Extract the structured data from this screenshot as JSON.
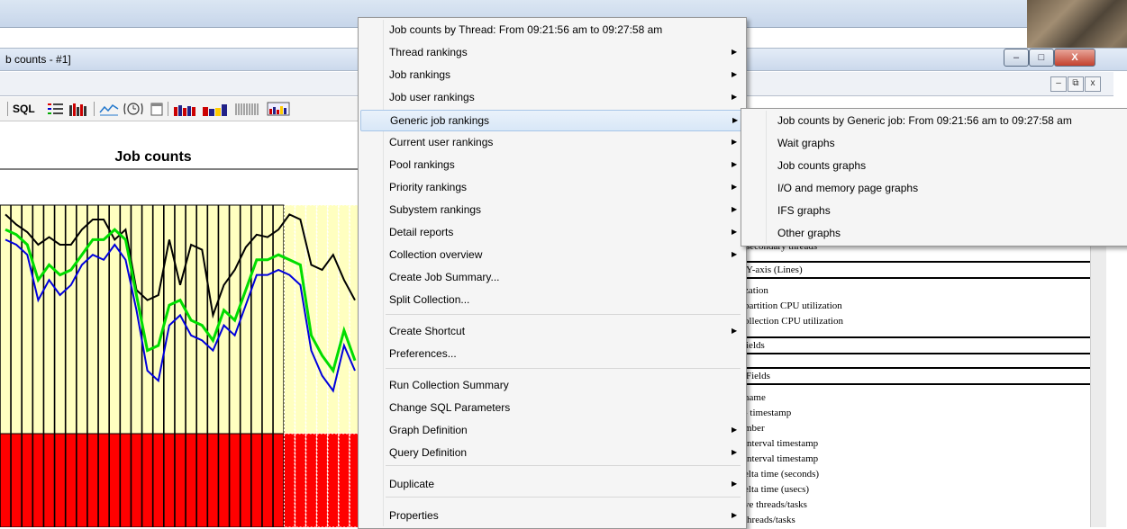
{
  "window": {
    "title": "b counts - #1]",
    "minimize": "–",
    "maximize": "□",
    "close": "X",
    "mdi_minimize": "–",
    "mdi_restore": "⧉",
    "mdi_close": "x"
  },
  "toolbar": {
    "sql": "SQL"
  },
  "chart_data": {
    "type": "bar",
    "title": "Job counts",
    "xlabel": "",
    "ylabel": "",
    "bar_colors": {
      "top": "#ffffc0",
      "bottom": "#ff0000"
    },
    "series": [
      {
        "color": "#000000",
        "values": [
          0.92,
          0.88,
          0.85,
          0.8,
          0.83,
          0.8,
          0.8,
          0.86,
          0.9,
          0.9,
          0.82,
          0.86,
          0.62,
          0.58,
          0.6,
          0.82,
          0.64,
          0.8,
          0.78,
          0.52,
          0.64,
          0.7,
          0.79,
          0.84,
          0.83,
          0.86,
          0.92,
          0.9,
          0.72,
          0.7,
          0.76,
          0.66,
          0.58
        ]
      },
      {
        "color": "#00dd00",
        "values": [
          0.86,
          0.84,
          0.8,
          0.66,
          0.72,
          0.68,
          0.7,
          0.76,
          0.82,
          0.82,
          0.86,
          0.82,
          0.6,
          0.38,
          0.4,
          0.56,
          0.58,
          0.5,
          0.48,
          0.42,
          0.54,
          0.5,
          0.62,
          0.74,
          0.74,
          0.76,
          0.74,
          0.72,
          0.44,
          0.36,
          0.3,
          0.46,
          0.34
        ]
      },
      {
        "color": "#0000dd",
        "values": [
          0.82,
          0.8,
          0.76,
          0.58,
          0.66,
          0.6,
          0.64,
          0.72,
          0.76,
          0.74,
          0.8,
          0.74,
          0.54,
          0.3,
          0.26,
          0.48,
          0.52,
          0.44,
          0.42,
          0.38,
          0.48,
          0.44,
          0.56,
          0.68,
          0.68,
          0.7,
          0.68,
          0.64,
          0.38,
          0.28,
          0.22,
          0.4,
          0.3
        ]
      }
    ]
  },
  "context_menu": {
    "items": [
      {
        "label": "Job counts by Thread: From 09:21:56 am to 09:27:58 am",
        "submenu": false
      },
      {
        "label": "Thread rankings",
        "submenu": true
      },
      {
        "label": "Job rankings",
        "submenu": true
      },
      {
        "label": "Job user rankings",
        "submenu": true
      },
      {
        "label": "Generic job rankings",
        "submenu": true,
        "highlighted": true
      },
      {
        "label": "Current user rankings",
        "submenu": true
      },
      {
        "label": "Pool rankings",
        "submenu": true
      },
      {
        "label": "Priority rankings",
        "submenu": true
      },
      {
        "label": "Subystem rankings",
        "submenu": true
      },
      {
        "label": "Detail reports",
        "submenu": true
      },
      {
        "label": "Collection overview",
        "submenu": true
      },
      {
        "label": "Create Job Summary...",
        "submenu": false
      },
      {
        "label": "Split Collection...",
        "submenu": false
      },
      {
        "label": "Create Shortcut",
        "submenu": true
      },
      {
        "label": "Preferences...",
        "submenu": false
      },
      {
        "label": "Run Collection Summary",
        "submenu": false
      },
      {
        "label": "Change SQL Parameters",
        "submenu": false
      },
      {
        "label": "Graph Definition",
        "submenu": true
      },
      {
        "label": "Query Definition",
        "submenu": true
      },
      {
        "label": "Duplicate",
        "submenu": true
      },
      {
        "label": "Properties",
        "submenu": true
      }
    ],
    "arrow": "▶"
  },
  "submenu": {
    "items": [
      {
        "label": "Job counts by Generic job: From 09:21:56 am to 09:27:58 am"
      },
      {
        "label": "Wait graphs"
      },
      {
        "label": "Job counts graphs"
      },
      {
        "label": "I/O and memory page graphs"
      },
      {
        "label": "IFS graphs"
      },
      {
        "label": "Other graphs"
      }
    ]
  },
  "right_panel": {
    "partial_header": "secondary threads",
    "box1": "Y-axis (Lines)",
    "list1": [
      "zation",
      "partition CPU utilization",
      "ollection CPU utilization"
    ],
    "box2": "ields",
    "box3": "Fields",
    "list2": [
      "name",
      "- timestamp",
      "mber",
      "interval timestamp",
      "interval timestamp",
      "elta time (seconds)",
      "elta time (usecs)",
      "ve threads/tasks",
      "threads/tasks"
    ]
  }
}
